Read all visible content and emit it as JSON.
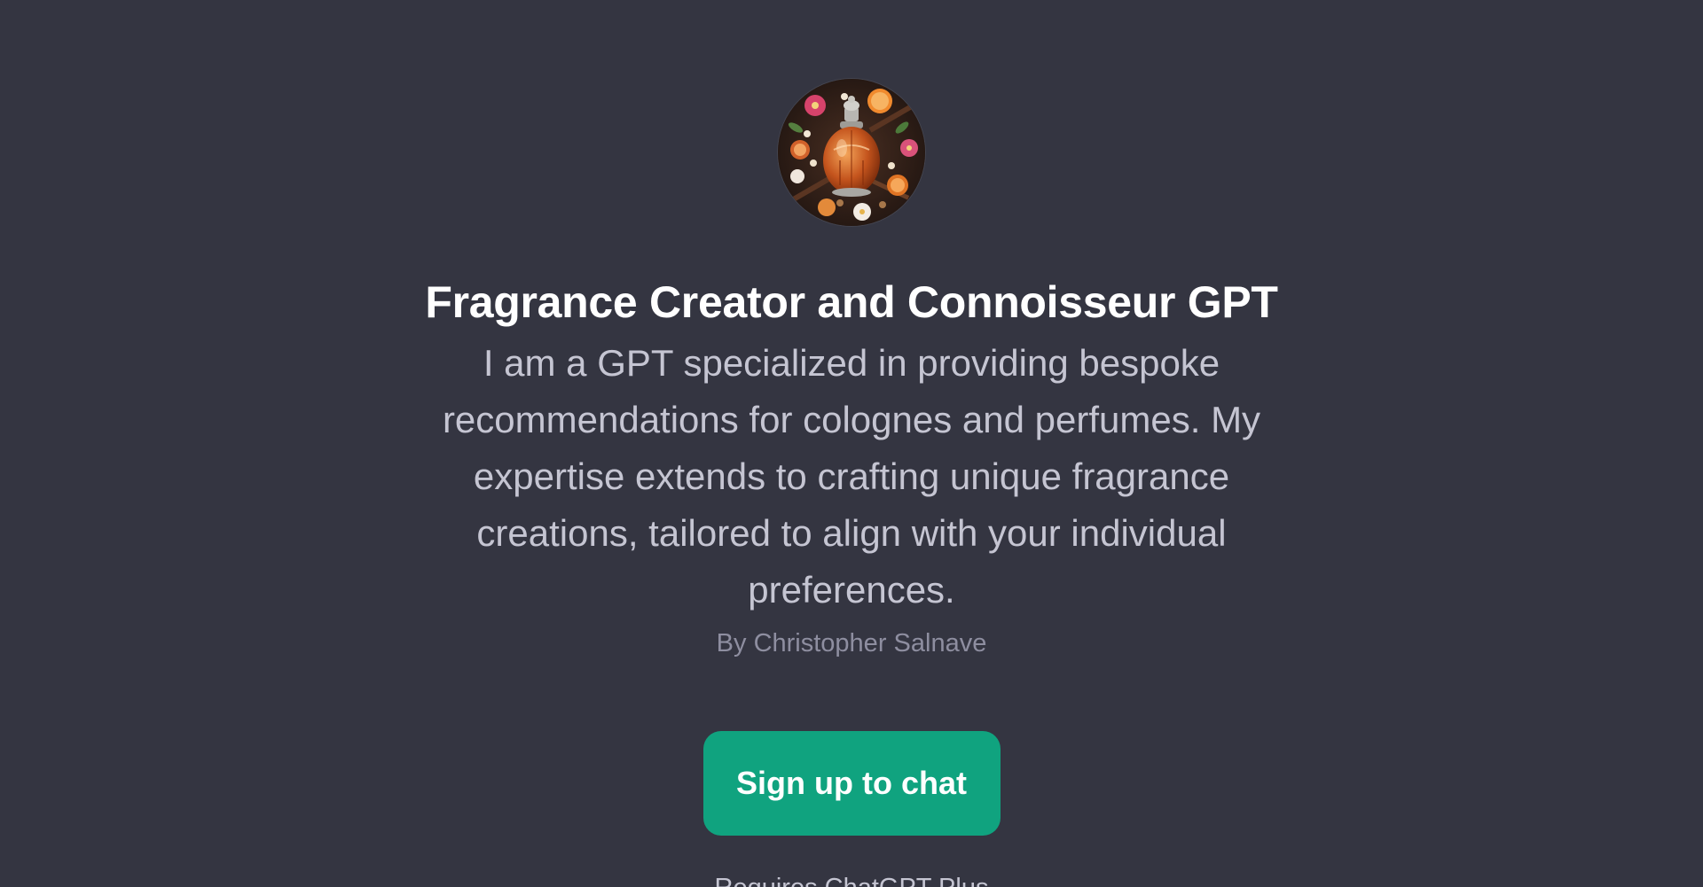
{
  "gpt": {
    "title": "Fragrance Creator and Connoisseur GPT",
    "description": "I am a GPT specialized in providing bespoke recommendations for colognes and perfumes. My expertise extends to crafting unique fragrance creations, tailored to align with your individual preferences.",
    "author": "By Christopher Salnave",
    "avatar_icon": "perfume-bottle-illustration"
  },
  "actions": {
    "signup_label": "Sign up to chat"
  },
  "footer": {
    "note": "Requires ChatGPT Plus"
  },
  "colors": {
    "background": "#343541",
    "accent": "#10a37f",
    "title": "#ffffff",
    "body_text": "#c5c5d2",
    "muted_text": "#8e8ea0"
  }
}
